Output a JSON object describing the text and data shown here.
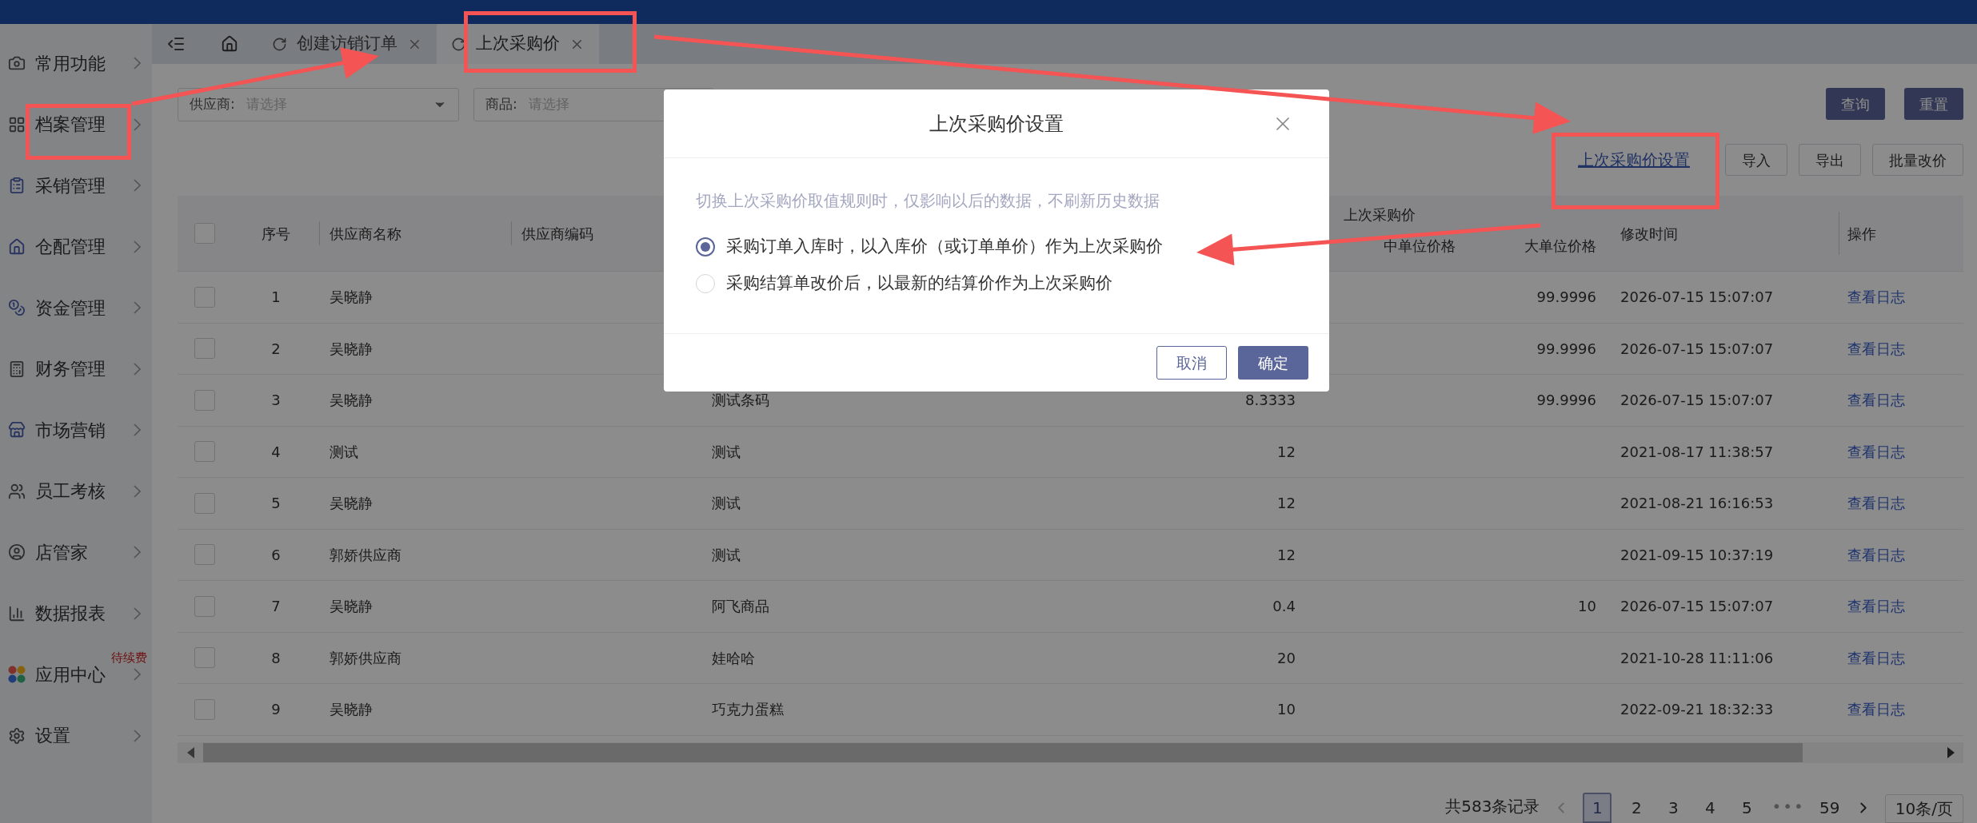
{
  "tabs": [
    {
      "label": "创建访销订单",
      "selected": false
    },
    {
      "label": "上次采购价",
      "selected": true
    }
  ],
  "sidebar": {
    "items": [
      {
        "label": "常用功能"
      },
      {
        "label": "档案管理"
      },
      {
        "label": "采销管理"
      },
      {
        "label": "仓配管理"
      },
      {
        "label": "资金管理"
      },
      {
        "label": "财务管理"
      },
      {
        "label": "市场营销"
      },
      {
        "label": "员工考核"
      },
      {
        "label": "店管家"
      },
      {
        "label": "数据报表"
      },
      {
        "label": "应用中心",
        "badge": "待续费"
      },
      {
        "label": "设置"
      }
    ]
  },
  "filters": [
    {
      "kind": "select",
      "label": "供应商:",
      "placeholder": "请选择"
    },
    {
      "kind": "input",
      "label": "商品:",
      "placeholder": "请选择"
    }
  ],
  "filter_buttons": [
    "查询",
    "重置"
  ],
  "toolbar": {
    "link": "上次采购价设置",
    "buttons": [
      "导入",
      "导出",
      "批量改价"
    ]
  },
  "table": {
    "select_all_checked": false,
    "columns": [
      "序号",
      "供应商名称",
      "供应商编码"
    ],
    "group": {
      "label": "上次采购价",
      "columns": [
        "中单位价格",
        "大单位价格"
      ]
    },
    "columns_after": [
      "修改时间",
      "操作"
    ],
    "rows": [
      {
        "checked": false,
        "index": "1",
        "supplier_name": "吴晓静",
        "large_unit_price": "99.9996",
        "modified": "2026-07-15 15:07:07",
        "action": "查看日志"
      },
      {
        "checked": false,
        "index": "2",
        "supplier_name": "吴晓静",
        "large_unit_price": "99.9996",
        "modified": "2026-07-15 15:07:07",
        "action": "查看日志"
      },
      {
        "checked": false,
        "index": "3",
        "supplier_name": "吴晓静",
        "column_4": "测试条码",
        "column_5": "8.3333",
        "large_unit_price": "99.9996",
        "modified": "2026-07-15 15:07:07",
        "action": "查看日志"
      },
      {
        "checked": false,
        "index": "4",
        "supplier_name": "测试",
        "column_4": "测试",
        "column_5": "12",
        "modified": "2021-08-17 11:38:57",
        "action": "查看日志"
      },
      {
        "checked": false,
        "index": "5",
        "supplier_name": "吴晓静",
        "column_4": "测试",
        "column_5": "12",
        "modified": "2021-08-21 16:16:53",
        "action": "查看日志"
      },
      {
        "checked": false,
        "index": "6",
        "supplier_name": "郭娇供应商",
        "column_4": "测试",
        "column_5": "12",
        "modified": "2021-09-15 10:37:19",
        "action": "查看日志"
      },
      {
        "checked": false,
        "index": "7",
        "supplier_name": "吴晓静",
        "column_4": "阿飞商品",
        "column_5": "0.4",
        "large_unit_price": "10",
        "modified": "2026-07-15 15:07:07",
        "action": "查看日志"
      },
      {
        "checked": false,
        "index": "8",
        "supplier_name": "郭娇供应商",
        "column_4": "娃哈哈",
        "column_5": "20",
        "modified": "2021-10-28 11:11:06",
        "action": "查看日志"
      },
      {
        "checked": false,
        "index": "9",
        "supplier_name": "吴晓静",
        "column_4": "巧克力蛋糕",
        "column_5": "10",
        "modified": "2022-09-21 18:32:33",
        "action": "查看日志"
      }
    ]
  },
  "pagination": {
    "total": "共583条记录",
    "pages": [
      {
        "kind": "page",
        "label": "1",
        "selected": true
      },
      {
        "kind": "page",
        "label": "2",
        "selected": false
      },
      {
        "kind": "page",
        "label": "3",
        "selected": false
      },
      {
        "kind": "page",
        "label": "4",
        "selected": false
      },
      {
        "kind": "page",
        "label": "5",
        "selected": false
      },
      {
        "kind": "ellipsis",
        "label": "•••"
      },
      {
        "kind": "page",
        "label": "59",
        "selected": false
      }
    ],
    "page_size": "10条/页"
  },
  "dialog": {
    "title": "上次采购价设置",
    "hint": "切换上次采购价取值规则时，仅影响以后的数据，不刷新历史数据",
    "options": [
      {
        "label": "采购订单入库时，以入库价（或订单单价）作为上次采购价",
        "selected": true
      },
      {
        "label": "采购结算单改价后，以最新的结算价作为上次采购价",
        "selected": false
      }
    ],
    "buttons": [
      {
        "kind": "default",
        "label": "取消"
      },
      {
        "kind": "primary",
        "label": "确定"
      }
    ]
  }
}
